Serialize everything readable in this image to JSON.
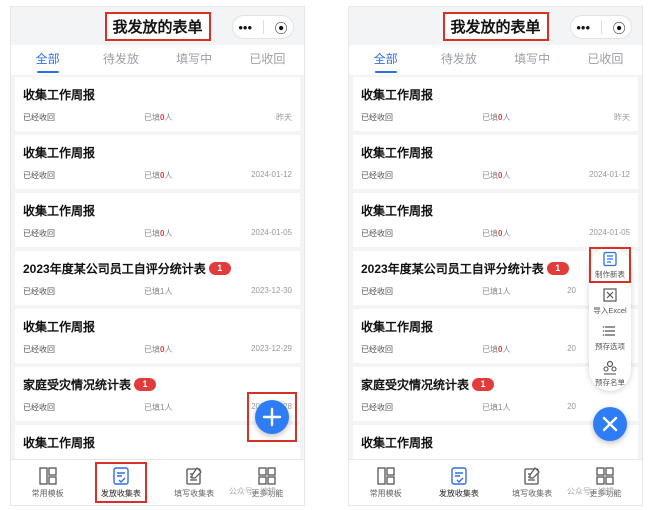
{
  "page_title": "我发放的表单",
  "capsule": {
    "more": "•••",
    "close": "⦿"
  },
  "tabs": [
    "全部",
    "待发放",
    "填写中",
    "已收回"
  ],
  "cards_left": [
    {
      "title": "收集工作周报",
      "badge": "",
      "status": "已经收回",
      "filled_prefix": "已填",
      "filled_count": "0",
      "filled_suffix": "人",
      "date": "昨天"
    },
    {
      "title": "收集工作周报",
      "badge": "",
      "status": "已经收回",
      "filled_prefix": "已填",
      "filled_count": "0",
      "filled_suffix": "人",
      "date": "2024-01-12"
    },
    {
      "title": "收集工作周报",
      "badge": "",
      "status": "已经收回",
      "filled_prefix": "已填",
      "filled_count": "0",
      "filled_suffix": "人",
      "date": "2024-01-05"
    },
    {
      "title": "2023年度某公司员工自评分统计表",
      "badge": "1",
      "status": "已经收回",
      "filled_prefix": "已填",
      "filled_count": "1",
      "filled_suffix": "人",
      "date": "2023-12-30"
    },
    {
      "title": "收集工作周报",
      "badge": "",
      "status": "已经收回",
      "filled_prefix": "已填",
      "filled_count": "0",
      "filled_suffix": "人",
      "date": "2023-12-29"
    },
    {
      "title": "家庭受灾情况统计表",
      "badge": "1",
      "status": "已经收回",
      "filled_prefix": "已填",
      "filled_count": "1",
      "filled_suffix": "人",
      "date": "2023-12-28"
    },
    {
      "title": "收集工作周报",
      "badge": "",
      "status": "",
      "filled_prefix": "",
      "filled_count": "",
      "filled_suffix": "",
      "date": ""
    }
  ],
  "cards_right": [
    {
      "title": "收集工作周报",
      "badge": "",
      "status": "已经收回",
      "filled_prefix": "已填",
      "filled_count": "0",
      "filled_suffix": "人",
      "date": "昨天"
    },
    {
      "title": "收集工作周报",
      "badge": "",
      "status": "已经收回",
      "filled_prefix": "已填",
      "filled_count": "0",
      "filled_suffix": "人",
      "date": "2024-01-12"
    },
    {
      "title": "收集工作周报",
      "badge": "",
      "status": "已经收回",
      "filled_prefix": "已填",
      "filled_count": "0",
      "filled_suffix": "人",
      "date": "2024-01-05"
    },
    {
      "title": "2023年度某公司员工自评分统计表",
      "badge": "1",
      "status": "已经收回",
      "filled_prefix": "已填",
      "filled_count": "1",
      "filled_suffix": "人",
      "date": "20"
    },
    {
      "title": "收集工作周报",
      "badge": "",
      "status": "已经收回",
      "filled_prefix": "已填",
      "filled_count": "0",
      "filled_suffix": "人",
      "date": "20"
    },
    {
      "title": "家庭受灾情况统计表",
      "badge": "1",
      "status": "已经收回",
      "filled_prefix": "已填",
      "filled_count": "1",
      "filled_suffix": "人",
      "date": "20"
    },
    {
      "title": "收集工作周报",
      "badge": "",
      "status": "",
      "filled_prefix": "",
      "filled_count": "",
      "filled_suffix": "",
      "date": ""
    }
  ],
  "bottom_nav": [
    {
      "label": "常用模板",
      "icon": "template-grid-icon"
    },
    {
      "label": "发放收集表",
      "icon": "send-form-icon"
    },
    {
      "label": "填写收集表",
      "icon": "fill-form-icon"
    },
    {
      "label": "更多功能",
      "icon": "more-grid-icon"
    }
  ],
  "watermark": "公众号 · 编辑",
  "fab_menu": [
    {
      "label": "制作新表",
      "icon": "new-form-icon"
    },
    {
      "label": "导入Excel",
      "icon": "import-excel-icon"
    },
    {
      "label": "预存选项",
      "icon": "preset-options-icon"
    },
    {
      "label": "预存名单",
      "icon": "preset-roster-icon"
    }
  ],
  "colors": {
    "accent": "#2f6fe4",
    "fab": "#2f7df6",
    "badge": "#e23b3b",
    "highlight": "#d93025"
  }
}
